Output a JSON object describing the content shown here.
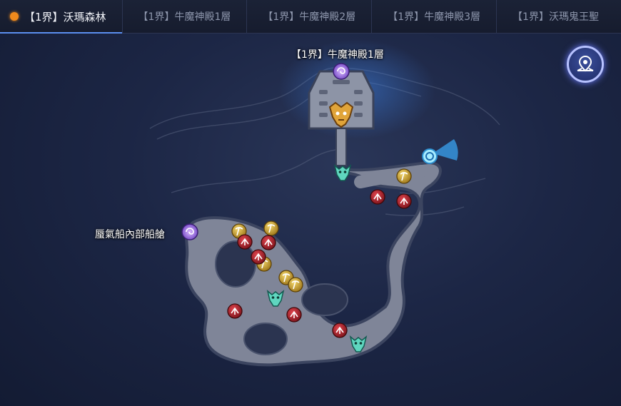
{
  "tabs": [
    {
      "label": "【1界】沃瑪森林",
      "active": true
    },
    {
      "label": "【1界】牛魔神殿1層",
      "active": false
    },
    {
      "label": "【1界】牛魔神殿2層",
      "active": false
    },
    {
      "label": "【1界】牛魔神殿3層",
      "active": false
    },
    {
      "label": "【1界】沃瑪鬼王聖",
      "active": false
    }
  ],
  "map": {
    "portal_labels": {
      "temple_entrance": "【1界】牛魔神殿1層",
      "airship_cabin": "蜃氣船內部船艙"
    },
    "icons": [
      "portal-icon",
      "boss-dragon-icon",
      "monster-head-icon",
      "pickaxe-icon",
      "herb-icon",
      "player-marker-icon"
    ]
  },
  "colors": {
    "active_dot": "#f08a1c",
    "accent": "#5b8ff0",
    "mining_node": "#c9a227",
    "herb_node": "#b0202a",
    "monster": "#4fd0b8",
    "portal": "#8a5bd8"
  },
  "locate_button": {
    "icon": "map-location-icon"
  }
}
